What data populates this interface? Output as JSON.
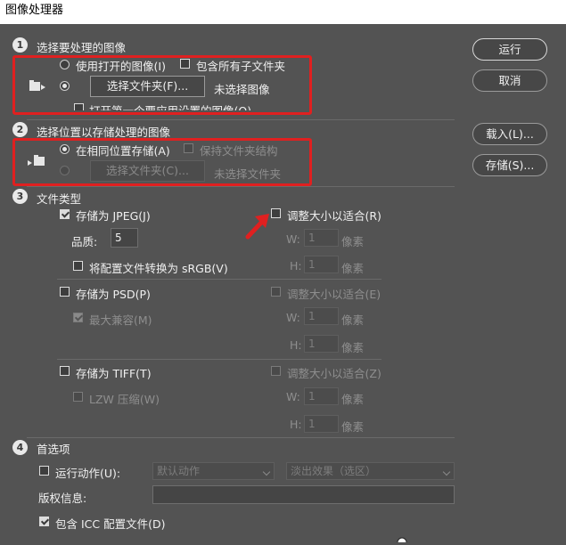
{
  "window": {
    "title": "图像处理器"
  },
  "section1": {
    "number": "1",
    "title": "选择要处理的图像",
    "use_open_images": "使用打开的图像(I)",
    "include_subfolders": "包含所有子文件夹",
    "select_folder_button": "选择文件夹(F)...",
    "no_image_selected": "未选择图像",
    "open_first_image": "打开第一个要应用设置的图像(O)"
  },
  "section2": {
    "number": "2",
    "title": "选择位置以存储处理的图像",
    "save_same_location": "在相同位置存储(A)",
    "keep_folder_structure": "保持文件夹结构",
    "select_folder_button": "选择文件夹(C)...",
    "no_folder_selected": "未选择文件夹"
  },
  "section3": {
    "number": "3",
    "title": "文件类型",
    "jpeg": {
      "save_as": "存储为 JPEG(J)",
      "resize": "调整大小以适合(R)",
      "quality_label": "品质:",
      "quality_value": "5",
      "w_label": "W:",
      "w_value": "1",
      "w_unit": "像素",
      "h_label": "H:",
      "h_value": "1",
      "h_unit": "像素",
      "convert_srgb": "将配置文件转换为 sRGB(V)"
    },
    "psd": {
      "save_as": "存储为 PSD(P)",
      "resize": "调整大小以适合(E)",
      "max_compat": "最大兼容(M)",
      "w_label": "W:",
      "w_value": "1",
      "w_unit": "像素",
      "h_label": "H:",
      "h_value": "1",
      "h_unit": "像素"
    },
    "tiff": {
      "save_as": "存储为 TIFF(T)",
      "resize": "调整大小以适合(Z)",
      "lzw": "LZW 压缩(W)",
      "w_label": "W:",
      "w_value": "1",
      "w_unit": "像素",
      "h_label": "H:",
      "h_value": "1",
      "h_unit": "像素"
    }
  },
  "section4": {
    "number": "4",
    "title": "首选项",
    "run_action": "运行动作(U):",
    "action_set": "默认动作",
    "action": "淡出效果（选区）",
    "copyright_label": "版权信息:",
    "copyright_value": "",
    "include_icc": "包含 ICC 配置文件(D)"
  },
  "buttons": {
    "run": "运行",
    "cancel": "取消",
    "load": "载入(L)...",
    "save": "存储(S)..."
  },
  "colors": {
    "background": "#535353",
    "highlight": "#e02020"
  }
}
